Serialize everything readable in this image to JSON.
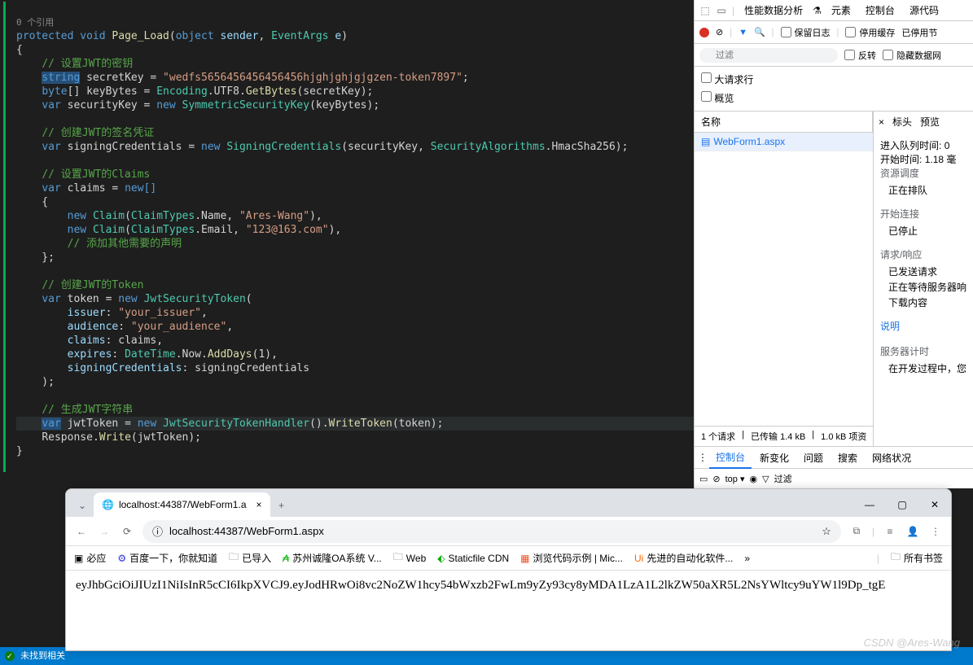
{
  "editor": {
    "references": "0 个引用",
    "status": "未找到相关",
    "code_tokens": {
      "protected": "protected",
      "void": "void",
      "Page_Load": "Page_Load",
      "object": "object",
      "sender": "sender",
      "EventArgs": "EventArgs",
      "e": "e",
      "c1": "// 设置JWT的密钥",
      "string": "string",
      "secretKey": "secretKey",
      "eq": " = ",
      "str1": "\"wedfs5656456456456456hjghjghjgjgzen-token7897\"",
      "byte": "byte",
      "arr": "[]",
      "keyBytes": "keyBytes",
      "Encoding": "Encoding",
      "UTF8": "UTF8",
      "GetBytes": "GetBytes",
      "var": "var",
      "securityKey": "securityKey",
      "new": "new",
      "SymmetricSecurityKey": "SymmetricSecurityKey",
      "c2": "// 创建JWT的签名凭证",
      "signingCredentials": "signingCredentials",
      "SigningCredentials": "SigningCredentials",
      "SecurityAlgorithms": "SecurityAlgorithms",
      "HmacSha256": "HmacSha256",
      "c3": "// 设置JWT的Claims",
      "claims": "claims",
      "newarr": "new[]",
      "Claim": "Claim",
      "ClaimTypes": "ClaimTypes",
      "Name": "Name",
      "ares": "\"Ares-Wang\"",
      "Email": "Email",
      "email": "\"123@163.com\"",
      "c4": "// 添加其他需要的声明",
      "c5": "// 创建JWT的Token",
      "token": "token",
      "JwtSecurityToken": "JwtSecurityToken",
      "issuer": "issuer",
      "issuer_v": "\"your_issuer\"",
      "audience": "audience",
      "aud_v": "\"your_audience\"",
      "claims_p": "claims",
      "expires": "expires",
      "DateTime": "DateTime",
      "Now": "Now",
      "AddDays": "AddDays",
      "one": "1",
      "sc_p": "signingCredentials",
      "c6": "// 生成JWT字符串",
      "jwtToken": "jwtToken",
      "JwtSecurityTokenHandler": "JwtSecurityTokenHandler",
      "WriteToken": "WriteToken",
      "Response": "Response",
      "Write": "Write"
    }
  },
  "devtools": {
    "top_tabs": {
      "perf": "性能数据分析",
      "elements": "元素",
      "console": "控制台",
      "sources": "源代码"
    },
    "toolbar": {
      "preserve": "保留日志",
      "disable_cache": "停用缓存",
      "throttle": "已停用节"
    },
    "filter": {
      "placeholder": "过滤",
      "invert": "反转",
      "hide_data": "隐藏数据网"
    },
    "checks": {
      "big_req": "大请求行",
      "overview": "概览"
    },
    "table": {
      "name_header": "名称",
      "request": "WebForm1.aspx",
      "headers_tab": "标头",
      "preview_tab": "预览"
    },
    "timing": {
      "queue_label": "进入队列时间:",
      "queue_val": "0",
      "start_label": "开始时间:",
      "start_val": "1.18 毫",
      "sched_label": "资源调度",
      "sched_val": "正在排队",
      "conn_label": "开始连接",
      "conn_val": "已停止",
      "req_label": "请求/响应",
      "req_v1": "已发送请求",
      "req_v2": "正在等待服务器响",
      "req_v3": "下载内容",
      "explain": "说明",
      "timer_label": "服务器计时",
      "timer_val": "在开发过程中，您"
    },
    "status": {
      "reqs": "1 个请求",
      "xfer": "已传输 1.4 kB",
      "res": "1.0 kB 项资"
    },
    "tabs": {
      "console": "控制台",
      "whats_new": "新变化",
      "issues": "问题",
      "search": "搜索",
      "network": "网络状况"
    },
    "console_ctx": {
      "top": "top ▾",
      "filter": "过滤"
    }
  },
  "browser": {
    "tab_title": "localhost:44387/WebForm1.a",
    "url": "localhost:44387/WebForm1.aspx",
    "bookmarks": {
      "apply": "必应",
      "baidu": "百度一下，你就知道",
      "import": "已导入",
      "suzhou": "苏州诚隆OA系统 V...",
      "web": "Web",
      "static": "Staticfile CDN",
      "browse": "浏览代码示例 | Mic...",
      "ui": "先进的自动化软件...",
      "all": "所有书签"
    },
    "content": "eyJhbGciOiJIUzI1NiIsInR5cCI6IkpXVCJ9.eyJodHRwOi8vc2NoZW1hcy54bWxzb2FwLm9yZy93cy8yMDA1LzA1L2lkZW50aXR5L2NsYWltcy9uYW1l9Dp_tgE"
  },
  "watermark": "CSDN @Ares-Wang"
}
